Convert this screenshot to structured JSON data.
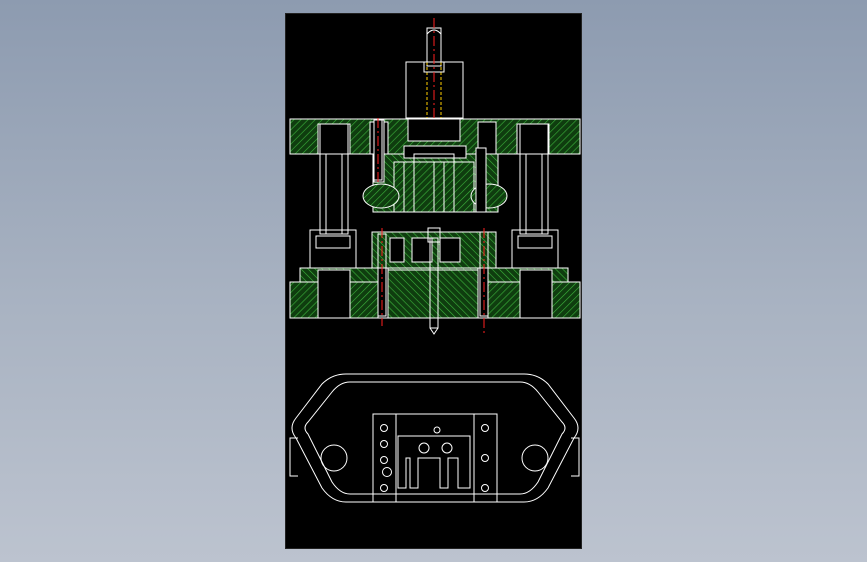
{
  "colors": {
    "page_background_top": "#8d9bb0",
    "page_background_bottom": "#bcc3cf",
    "canvas_background": "#000000",
    "outline": "#ffffff",
    "hatch": "#2e8b2e",
    "hatch_fill": "#0f3d0f",
    "centerline": "#ff2020",
    "hidden_line": "#ffd000"
  },
  "drawing": {
    "views": [
      "front-section-view",
      "top-plan-view"
    ]
  }
}
